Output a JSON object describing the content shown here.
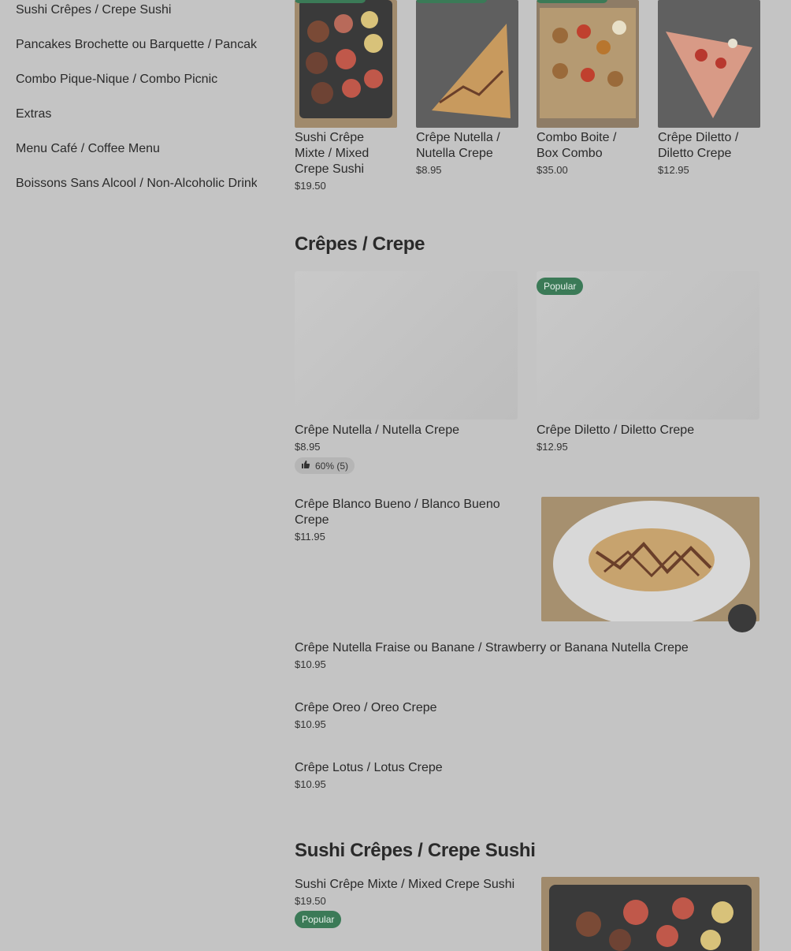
{
  "sidebar": {
    "items": [
      "Sushi Crêpes / Crepe Sushi",
      "Pancakes Brochette ou Barquette / Pancakes",
      "Combo Pique-Nique / Combo Picnic",
      "Extras",
      "Menu Café / Coffee Menu",
      "Boissons Sans Alcool / Non-Alcoholic Drinks"
    ]
  },
  "popular": [
    {
      "name": "Sushi Crêpe Mixte / Mixed Crepe Sushi",
      "price": "$19.50"
    },
    {
      "name": "Crêpe Nutella / Nutella Crepe",
      "price": "$8.95"
    },
    {
      "name": "Combo Boite / Box Combo",
      "price": "$35.00"
    },
    {
      "name": "Crêpe Diletto / Diletto Crepe",
      "price": "$12.95"
    }
  ],
  "crepes": {
    "title": "Crêpes / Crepe",
    "featured": [
      {
        "name": "Crêpe Nutella / Nutella Crepe",
        "price": "$8.95",
        "rating": "60% (5)"
      },
      {
        "name": "Crêpe Diletto / Diletto Crepe",
        "price": "$12.95",
        "badge": "Popular"
      }
    ],
    "items": [
      {
        "name": "Crêpe Blanco Bueno / Blanco Bueno Crepe",
        "price": "$11.95"
      },
      {
        "name": "Crêpe Nutella Fraise ou Banane / Strawberry or Banana Nutella Crepe",
        "price": "$10.95"
      },
      {
        "name": "Crêpe Oreo / Oreo Crepe",
        "price": "$10.95"
      },
      {
        "name": "Crêpe Lotus / Lotus Crepe",
        "price": "$10.95"
      }
    ]
  },
  "sushi": {
    "title": "Sushi Crêpes / Crepe Sushi",
    "items": [
      {
        "name": "Sushi Crêpe Mixte / Mixed Crepe Sushi",
        "price": "$19.50",
        "badge": "Popular"
      }
    ]
  },
  "icons": {
    "rating": "thumbs-up-icon",
    "add": "plus-icon"
  },
  "colors": {
    "accent": "#3b7a57",
    "overlay": "#c4c4c4"
  }
}
